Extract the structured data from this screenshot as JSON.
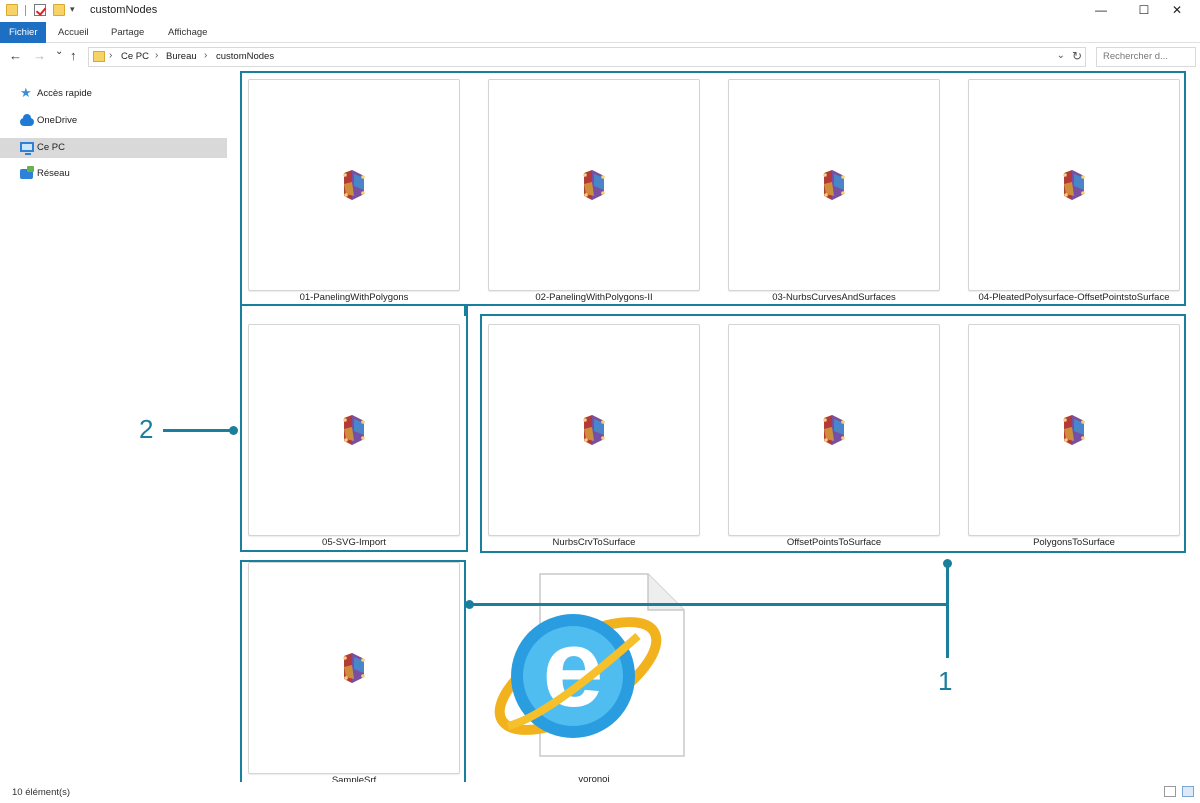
{
  "window": {
    "title": "customNodes",
    "minimize": "—",
    "maximize": "☐",
    "close": "✕",
    "quick_access_dropdown": "▾"
  },
  "ribbon": {
    "tabs": [
      "Fichier",
      "Accueil",
      "Partage",
      "Affichage"
    ],
    "accent": "#1d6fc4"
  },
  "nav": {
    "back": "←",
    "forward": "→",
    "recent": "⌄",
    "up": "↑"
  },
  "address": {
    "crumbs": [
      "Ce PC",
      "Bureau",
      "customNodes"
    ],
    "separator": "›",
    "dropdown": "⌄",
    "refresh": "↻"
  },
  "search": {
    "placeholder": "Rechercher d..."
  },
  "sidebar": {
    "items": [
      {
        "label": "Accès rapide",
        "icon": "quick-access-star-icon"
      },
      {
        "label": "OneDrive",
        "icon": "onedrive-cloud-icon"
      },
      {
        "label": "Ce PC",
        "icon": "computer-monitor-icon",
        "selected": true
      },
      {
        "label": "Réseau",
        "icon": "network-icon"
      }
    ]
  },
  "files": [
    {
      "name": "01-PanelingWithPolygons",
      "icon": "dynamo-icon"
    },
    {
      "name": "02-PanelingWithPolygons-II",
      "icon": "dynamo-icon"
    },
    {
      "name": "03-NurbsCurvesAndSurfaces",
      "icon": "dynamo-icon"
    },
    {
      "name": "04-PleatedPolysurface-OffsetPointstoSurface",
      "icon": "dynamo-icon"
    },
    {
      "name": "05-SVG-Import",
      "icon": "dynamo-icon"
    },
    {
      "name": "NurbsCrvToSurface",
      "icon": "dynamo-icon"
    },
    {
      "name": "OffsetPointsToSurface",
      "icon": "dynamo-icon"
    },
    {
      "name": "PolygonsToSurface",
      "icon": "dynamo-icon"
    },
    {
      "name": "SampleSrf",
      "icon": "dynamo-icon"
    },
    {
      "name": "voronoi",
      "icon": "internet-explorer-html-icon"
    }
  ],
  "annotations": {
    "label_1": "1",
    "label_2": "2",
    "color": "#1a7f9d"
  },
  "status": {
    "count": "10 élément(s)"
  }
}
